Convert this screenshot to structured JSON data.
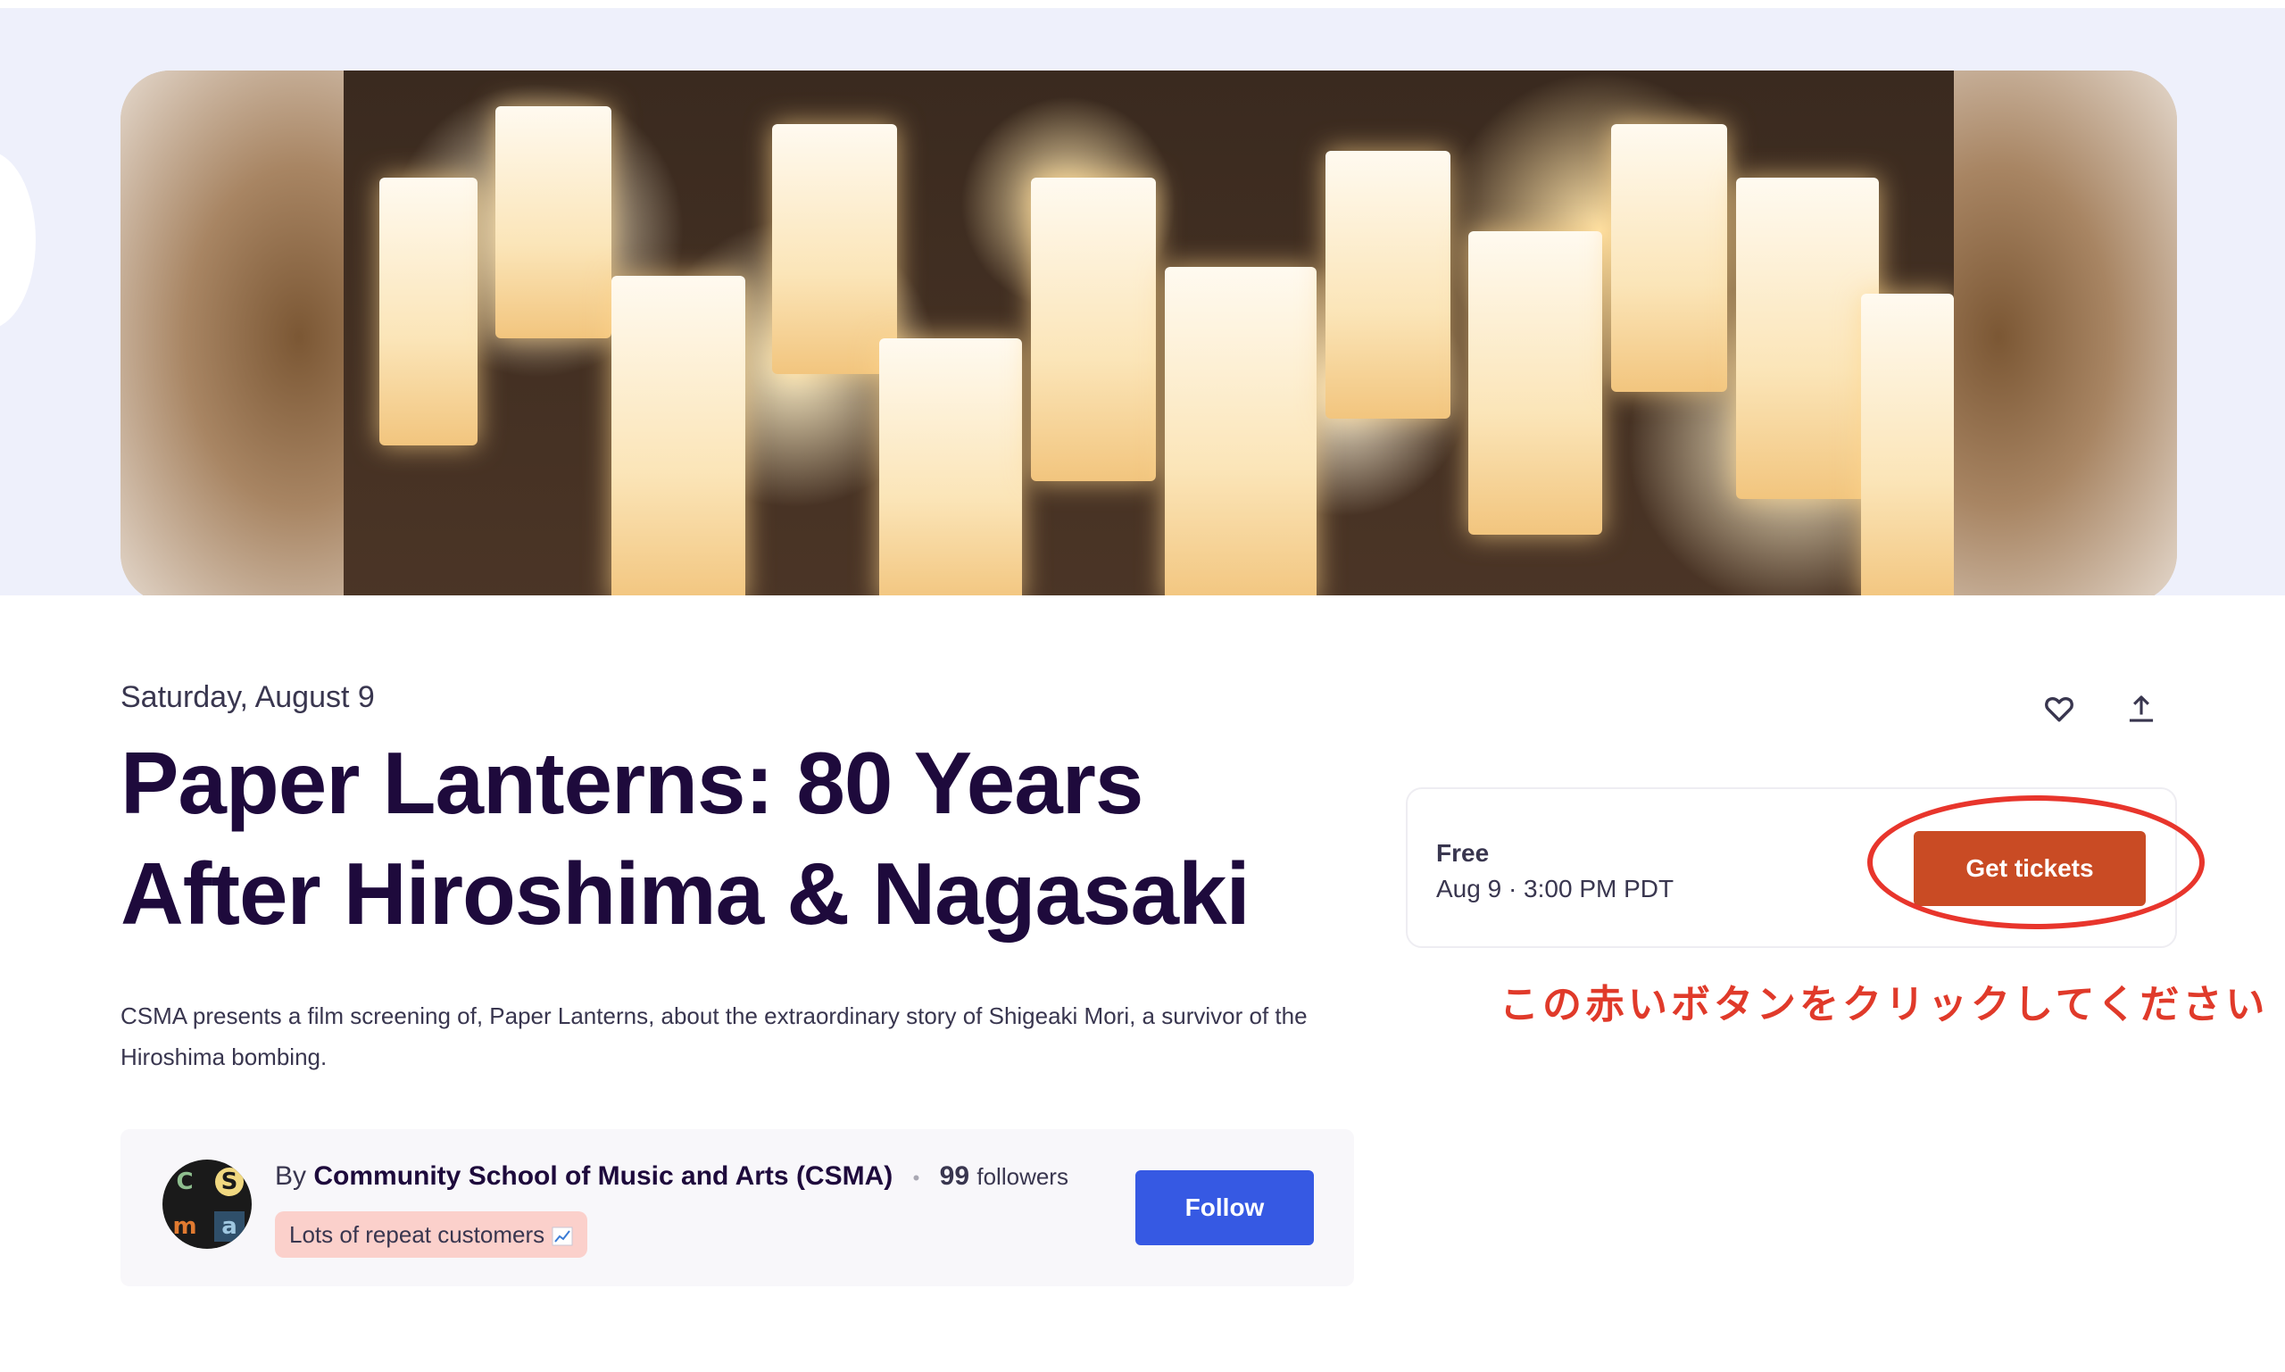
{
  "event": {
    "date": "Saturday, August 9",
    "title": "Paper Lanterns: 80 Years After Hiroshima & Nagasaki",
    "summary": "CSMA presents a film screening of, Paper Lanterns, about the extraordinary story of Shigeaki Mori, a survivor of the Hiroshima bombing."
  },
  "organizer": {
    "by_prefix": "By",
    "name": "Community School of Music and Arts (CSMA)",
    "separator": "•",
    "followers_count": "99",
    "followers_label": "followers",
    "badge": "Lots of repeat customers",
    "follow_button": "Follow",
    "avatar_letters": [
      "C",
      "S",
      "m",
      "a"
    ]
  },
  "ticket": {
    "price": "Free",
    "datetime": "Aug 9 · 3:00 PM PDT",
    "button": "Get tickets"
  },
  "annotation": {
    "text": "この赤いボタンをクリックしてください"
  },
  "icons": {
    "like": "heart-icon",
    "share": "share-upload-icon",
    "badge": "chart-increasing-icon"
  },
  "colors": {
    "title": "#1e0a3c",
    "get_tickets": "#c94b24",
    "follow": "#3659e3",
    "badge_bg": "#fbd0cb",
    "annotation": "#e03a2a",
    "hero_band": "#eef0fb"
  }
}
